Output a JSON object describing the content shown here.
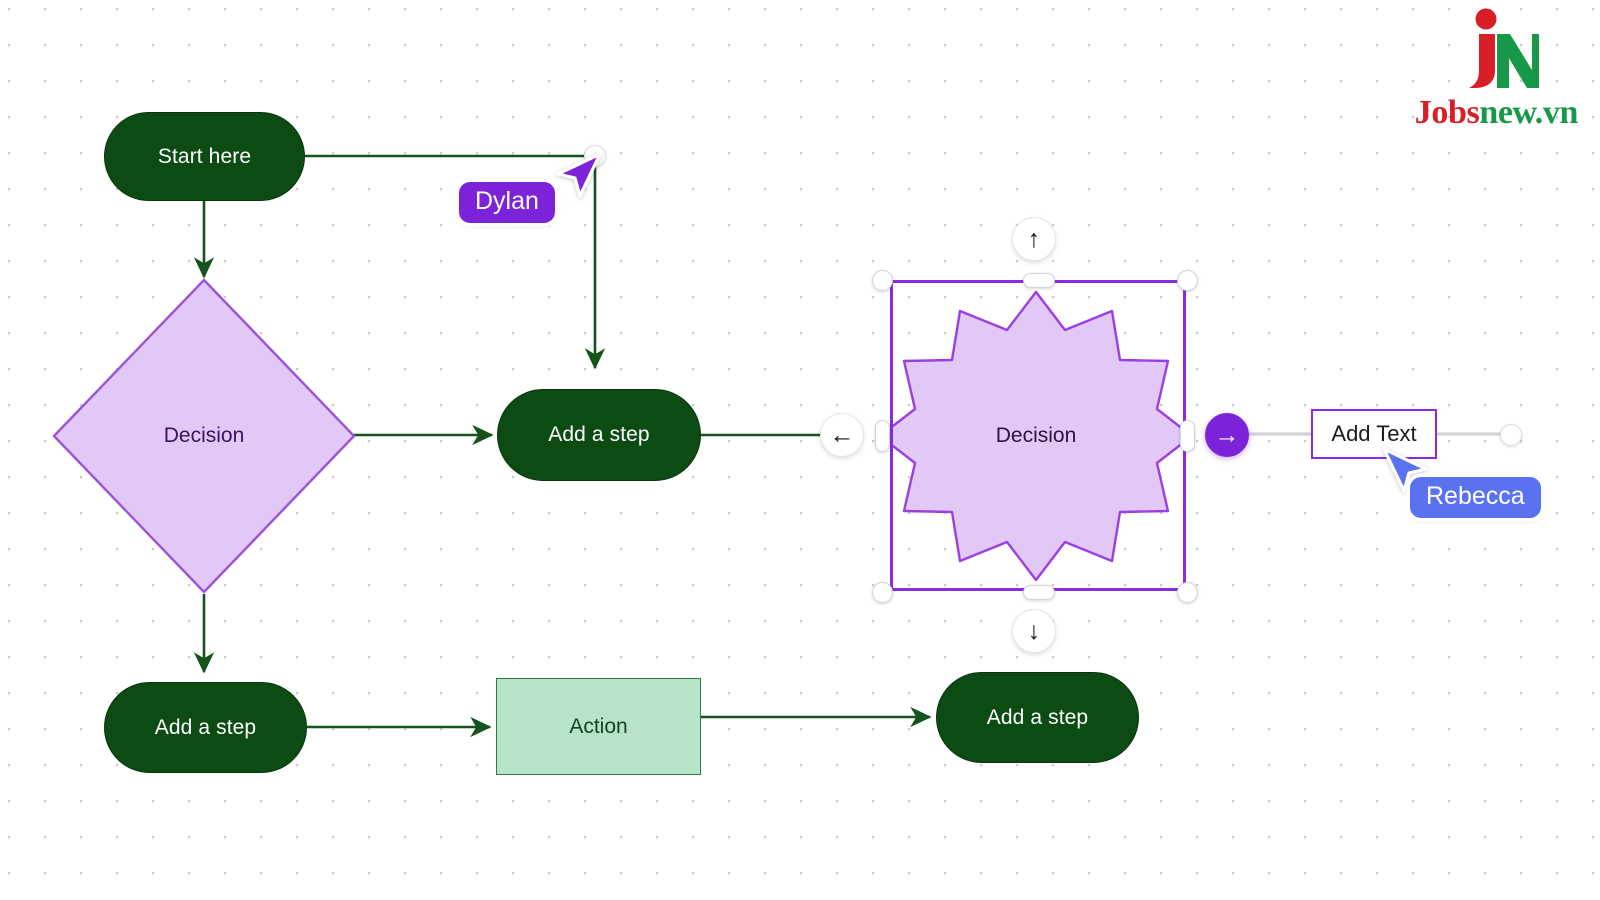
{
  "canvas": {
    "background": "#ffffff",
    "dot_grid_color": "#c8c8d0",
    "grid_spacing": 36
  },
  "brand": {
    "mark_label": "JN",
    "word_part_1": "Jobs",
    "word_part_2": "new.vn",
    "color_red": "#d81f26",
    "color_green": "#18994a"
  },
  "nodes": {
    "start": {
      "label": "Start here",
      "shape": "pill",
      "fill": "#0d4b14",
      "text_color": "#ffffff"
    },
    "decision_diamond": {
      "label": "Decision",
      "shape": "diamond",
      "fill": "#e2c8f7",
      "stroke": "#9a53d6",
      "text_color": "#3a1460"
    },
    "step_mid": {
      "label": "Add a step",
      "shape": "pill",
      "fill": "#0d4b14",
      "text_color": "#ffffff"
    },
    "decision_burst": {
      "label": "Decision",
      "shape": "starburst-12",
      "fill": "#e2c8f7",
      "stroke": "#9a3fe0",
      "text_color": "#2e1245"
    },
    "step_bottom_left": {
      "label": "Add a step",
      "shape": "pill",
      "fill": "#0d4b14",
      "text_color": "#ffffff"
    },
    "action": {
      "label": "Action",
      "shape": "rectangle",
      "fill": "#b7e3c6",
      "stroke": "#2e7d46",
      "text_color": "#12451f"
    },
    "step_bottom_right": {
      "label": "Add a step",
      "shape": "pill",
      "fill": "#0d4b14",
      "text_color": "#ffffff"
    }
  },
  "edges": {
    "stroke_color": "#14541c",
    "pending_stroke_color": "#d2d2d8"
  },
  "selection": {
    "box_color": "#8b2ae0",
    "handle_fill": "#ffffff",
    "handle_stroke": "#d3d3dd"
  },
  "arrow_buttons": {
    "up": {
      "glyph": "↑",
      "state": "idle"
    },
    "down": {
      "glyph": "↓",
      "state": "idle"
    },
    "left": {
      "glyph": "←",
      "state": "idle"
    },
    "right": {
      "glyph": "→",
      "state": "active",
      "active_fill": "#7c22d8"
    }
  },
  "add_text": {
    "label": "Add Text",
    "border_color": "#8b2ae0"
  },
  "cursors": [
    {
      "name": "Dylan",
      "color": "#7c22d8"
    },
    {
      "name": "Rebecca",
      "color": "#5b72f0"
    }
  ]
}
